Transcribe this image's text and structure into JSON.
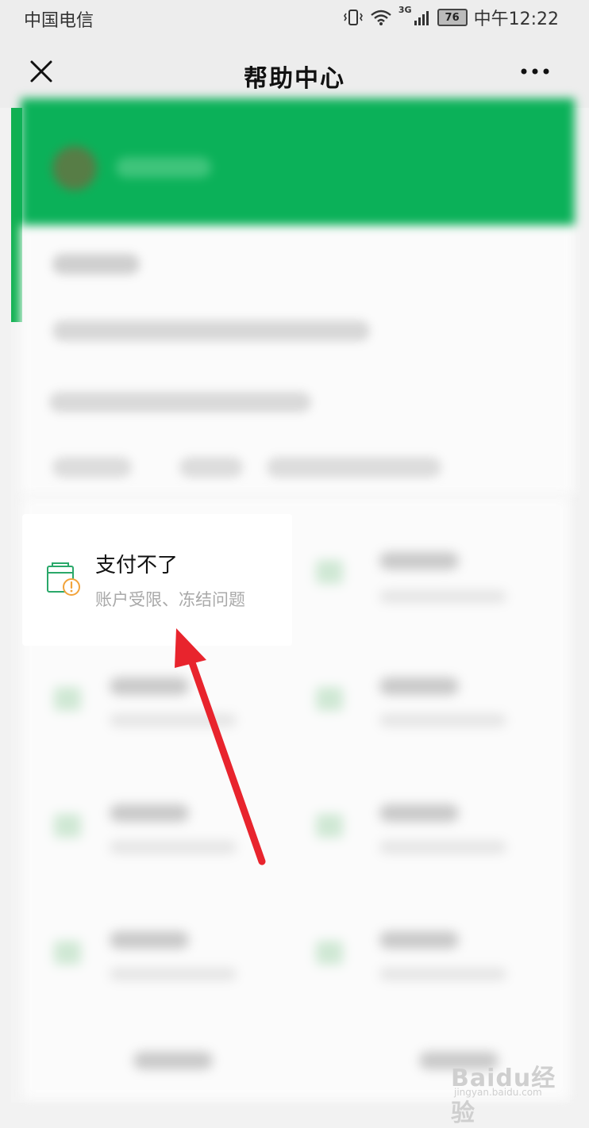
{
  "status_bar": {
    "carrier": "中国电信",
    "network": "3G",
    "battery": "76",
    "time": "中午12:22"
  },
  "nav": {
    "title": "帮助中心",
    "close_icon": "close-icon",
    "more_icon": "more-dots-icon"
  },
  "focus_tile": {
    "title": "支付不了",
    "subtitle": "账户受限、冻结问题",
    "icon": "wallet-warning-icon"
  },
  "watermark": {
    "brand": "Baidu经验",
    "url": "jingyan.baidu.com"
  },
  "colors": {
    "brand_green": "#0bb159",
    "arrow_red": "#e8242d",
    "tile_icon_green": "#2aa86a",
    "tile_icon_orange": "#f2a33a"
  }
}
